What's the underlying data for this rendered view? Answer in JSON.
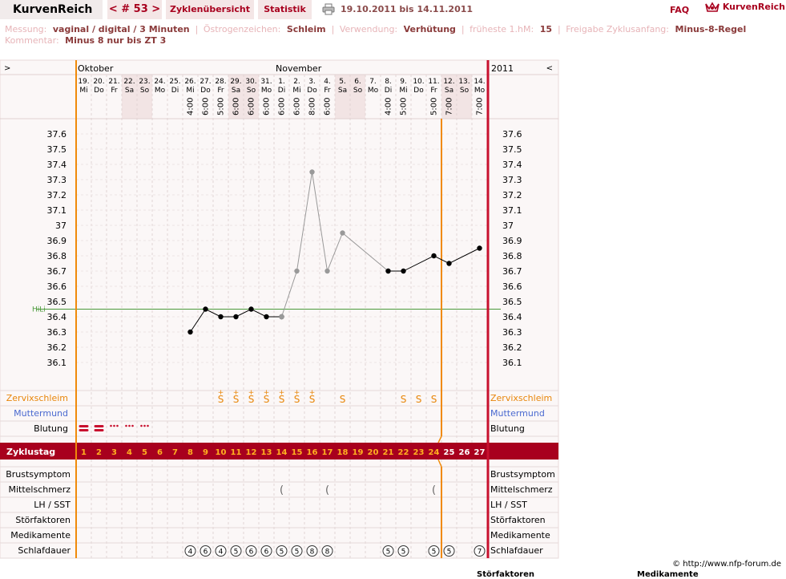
{
  "topbar": {
    "app_name": "KurvenReich",
    "cycle_nav": "< # 53 >",
    "tabs": [
      "Zyklenübersicht",
      "Statistik"
    ],
    "print_icon": "printer-icon",
    "date_range": "19.10.2011 bis 14.11.2011",
    "faq": "FAQ",
    "brand": "KurvenReich",
    "brand_icon": "crown-icon"
  },
  "info": {
    "measurement_label": "Messung:",
    "measurement_value": "vaginal / digital / 3 Minuten",
    "estrogen_label": "Östrogenzeichen:",
    "estrogen_value": "Schleim",
    "usage_label": "Verwendung:",
    "usage_value": "Verhütung",
    "earliest_label": "früheste 1.hM:",
    "earliest_value": "15",
    "release_label": "Freigabe Zyklusanfang:",
    "release_value": "Minus-8-Regel",
    "comment_label": "Kommentar:",
    "comment_value": "Minus 8 nur bis ZT 3"
  },
  "chart_data": {
    "type": "line",
    "title": "",
    "nav_left": ">",
    "nav_right": "<",
    "month_labels": [
      {
        "label": "Oktober",
        "col": 0
      },
      {
        "label": "November",
        "col": 13
      }
    ],
    "year_label": "2011",
    "days": [
      {
        "date": "19.",
        "wd": "Mi",
        "time": ""
      },
      {
        "date": "20.",
        "wd": "Do",
        "time": ""
      },
      {
        "date": "21.",
        "wd": "Fr",
        "time": ""
      },
      {
        "date": "22.",
        "wd": "Sa",
        "time": ""
      },
      {
        "date": "23.",
        "wd": "So",
        "time": ""
      },
      {
        "date": "24.",
        "wd": "Mo",
        "time": ""
      },
      {
        "date": "25.",
        "wd": "Di",
        "time": ""
      },
      {
        "date": "26.",
        "wd": "Mi",
        "time": "4:00"
      },
      {
        "date": "27.",
        "wd": "Do",
        "time": "6:00"
      },
      {
        "date": "28.",
        "wd": "Fr",
        "time": "5:00"
      },
      {
        "date": "29.",
        "wd": "Sa",
        "time": "6:00"
      },
      {
        "date": "30.",
        "wd": "So",
        "time": "6:00"
      },
      {
        "date": "31.",
        "wd": "Mo",
        "time": "6:00"
      },
      {
        "date": "1.",
        "wd": "Di",
        "time": "6:00"
      },
      {
        "date": "2.",
        "wd": "Mi",
        "time": "6:00"
      },
      {
        "date": "3.",
        "wd": "Do",
        "time": "8:00"
      },
      {
        "date": "4.",
        "wd": "Fr",
        "time": "6:00"
      },
      {
        "date": "5.",
        "wd": "Sa",
        "time": ""
      },
      {
        "date": "6.",
        "wd": "So",
        "time": ""
      },
      {
        "date": "7.",
        "wd": "Mo",
        "time": ""
      },
      {
        "date": "8.",
        "wd": "Di",
        "time": "4:00"
      },
      {
        "date": "9.",
        "wd": "Mi",
        "time": "5:00"
      },
      {
        "date": "10.",
        "wd": "Do",
        "time": ""
      },
      {
        "date": "11.",
        "wd": "Fr",
        "time": "5:00"
      },
      {
        "date": "12.",
        "wd": "Sa",
        "time": "7:00"
      },
      {
        "date": "13.",
        "wd": "So",
        "time": ""
      },
      {
        "date": "14.",
        "wd": "Mo",
        "time": "7:00"
      }
    ],
    "y_ticks": [
      "37.6",
      "37.5",
      "37.4",
      "37.3",
      "37.2",
      "37.1",
      "37",
      "36.9",
      "36.8",
      "36.7",
      "36.6",
      "36.5",
      "36.4",
      "36.3",
      "36.2",
      "36.1"
    ],
    "ylim": [
      36.1,
      37.6
    ],
    "hili_label": "HiLi",
    "hili_value": 36.45,
    "series": [
      {
        "color": "#000000",
        "points": [
          [
            7,
            36.3
          ],
          [
            8,
            36.45
          ],
          [
            9,
            36.4
          ],
          [
            10,
            36.4
          ],
          [
            11,
            36.45
          ],
          [
            12,
            36.4
          ],
          [
            13,
            36.4
          ]
        ]
      },
      {
        "color": "#999999",
        "points": [
          [
            13,
            36.4
          ],
          [
            14,
            36.7
          ],
          [
            15,
            37.35
          ],
          [
            16,
            36.7
          ],
          [
            17,
            36.95
          ],
          [
            20,
            36.7
          ]
        ]
      },
      {
        "color": "#000000",
        "points": [
          [
            20,
            36.7
          ],
          [
            21,
            36.7
          ],
          [
            23,
            36.8
          ],
          [
            24,
            36.75
          ],
          [
            26,
            36.85
          ]
        ]
      }
    ],
    "mucus_label": "Zervixschleim",
    "mucus": [
      {
        "col": 9,
        "sym": "S+"
      },
      {
        "col": 10,
        "sym": "S+"
      },
      {
        "col": 11,
        "sym": "S+"
      },
      {
        "col": 12,
        "sym": "S+"
      },
      {
        "col": 13,
        "sym": "S+"
      },
      {
        "col": 14,
        "sym": "S+"
      },
      {
        "col": 15,
        "sym": "S+"
      },
      {
        "col": 17,
        "sym": "S"
      },
      {
        "col": 21,
        "sym": "S"
      },
      {
        "col": 22,
        "sym": "S"
      },
      {
        "col": 23,
        "sym": "S"
      }
    ],
    "cervix_label": "Muttermund",
    "bleeding_label": "Blutung",
    "bleeding": [
      {
        "col": 0,
        "type": "heavy"
      },
      {
        "col": 1,
        "type": "heavy"
      },
      {
        "col": 2,
        "type": "dots"
      },
      {
        "col": 3,
        "type": "dots"
      },
      {
        "col": 4,
        "type": "dots"
      }
    ],
    "cycleday_label": "Zyklustag",
    "cycle_days": [
      "1",
      "2",
      "3",
      "4",
      "5",
      "6",
      "7",
      "8",
      "9",
      "10",
      "11",
      "12",
      "13",
      "14",
      "15",
      "16",
      "17",
      "18",
      "19",
      "20",
      "21",
      "22",
      "23",
      "24",
      "25",
      "26",
      "27"
    ],
    "lower_rows": [
      "Brustsymptom",
      "Mittelschmerz",
      "LH / SST",
      "Störfaktoren",
      "Medikamente",
      "Schlafdauer"
    ],
    "mittelschmerz_cols": [
      13,
      16,
      23
    ],
    "sleep": [
      {
        "col": 7,
        "v": "4"
      },
      {
        "col": 8,
        "v": "6"
      },
      {
        "col": 9,
        "v": "4"
      },
      {
        "col": 10,
        "v": "5"
      },
      {
        "col": 11,
        "v": "6"
      },
      {
        "col": 12,
        "v": "6"
      },
      {
        "col": 13,
        "v": "5"
      },
      {
        "col": 14,
        "v": "5"
      },
      {
        "col": 15,
        "v": "8"
      },
      {
        "col": 16,
        "v": "8"
      },
      {
        "col": 20,
        "v": "5"
      },
      {
        "col": 21,
        "v": "5"
      },
      {
        "col": 23,
        "v": "5"
      },
      {
        "col": 24,
        "v": "5"
      },
      {
        "col": 26,
        "v": "7"
      }
    ],
    "weekend_cols": [
      3,
      4,
      10,
      11,
      17,
      18,
      24,
      25
    ],
    "orange_line_cols": [
      0,
      23
    ],
    "red_line_after_col": 26
  },
  "footer": "© http://www.nfp-forum.de",
  "cropped_bottom": [
    "Störfaktoren",
    "Medikamente"
  ]
}
